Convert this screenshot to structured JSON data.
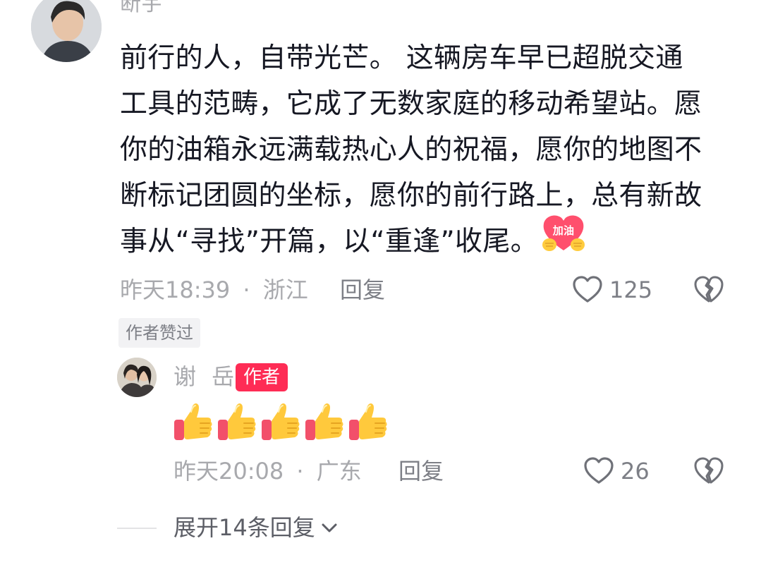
{
  "comment": {
    "username": "断宇",
    "text_lines": [
      "前行的人，自带光芒。 这辆房车早已超脱交通",
      "工具的范畴，它成了无数家庭的移动希望站。愿",
      "你的油箱永远满载热心人的祝福，愿你的地图不",
      "断标记团圆的坐标，愿你的前行路上，总有新故",
      "事从“寻找”开篇，以“重逢”收尾。"
    ],
    "sticker_label": "加油",
    "time": "昨天18:39",
    "separator": "·",
    "location": "浙江",
    "reply_label": "回复",
    "like_count": "125",
    "author_liked_tag": "作者赞过"
  },
  "reply": {
    "username": "谢 岳",
    "author_badge": "作者",
    "emoji_count": 5,
    "time": "昨天20:08",
    "separator": "·",
    "location": "广东",
    "reply_label": "回复",
    "like_count": "26"
  },
  "expand": {
    "label": "展开14条回复"
  },
  "colors": {
    "badge_red": "#fe2c55",
    "meta_gray": "#a8a9ad",
    "text_dark": "#161823"
  },
  "icons": {
    "like": "heart-outline-icon",
    "dislike": "broken-heart-icon",
    "expand": "chevron-down-icon",
    "emoji": "thumbs-up-emoji"
  }
}
